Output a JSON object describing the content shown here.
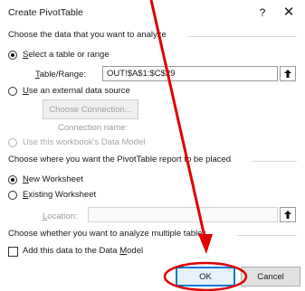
{
  "dialog": {
    "title": "Create PivotTable",
    "help_label": "?",
    "close_label": "✕"
  },
  "source": {
    "heading": "Choose the data that you want to analyze",
    "select_table": {
      "prefix": "",
      "accel": "S",
      "rest": "elect a table or range",
      "checked": true
    },
    "table_range": {
      "accel": "T",
      "rest": "able/Range:",
      "value": "OUT!$A$1:$C$29"
    },
    "external": {
      "accel": "U",
      "rest": "se an external data source",
      "checked": false
    },
    "choose_connection_label": "Choose Connection...",
    "connection_name_label": "Connection name:",
    "data_model_option": "Use this workbook's Data Model"
  },
  "placement": {
    "heading": "Choose where you want the PivotTable report to be placed",
    "new_worksheet": {
      "accel": "N",
      "rest": "ew Worksheet",
      "checked": true
    },
    "existing_worksheet": {
      "accel": "E",
      "rest": "xisting Worksheet",
      "checked": false
    },
    "location": {
      "accel": "L",
      "rest": "ocation:",
      "value": ""
    }
  },
  "multiple": {
    "heading": "Choose whether you want to analyze multiple tables",
    "add_data_model": {
      "before": "Add this data to the Data ",
      "accel": "M",
      "after": "odel",
      "checked": false
    }
  },
  "buttons": {
    "ok": "OK",
    "cancel": "Cancel"
  },
  "annotation_colors": {
    "arrow": "#e00000",
    "ellipse": "#e00000"
  }
}
